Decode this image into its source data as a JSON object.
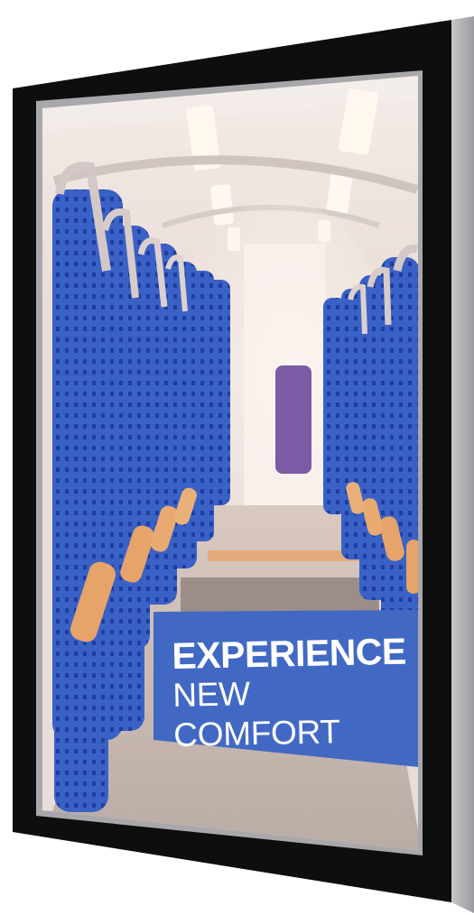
{
  "poster": {
    "headline_line1": "EXPERIENCE",
    "headline_line2": "NEW COMFORT"
  },
  "colors": {
    "frame": "#0d0d0d",
    "frame_edge": "#b9b9bc",
    "seat_blue": "#3b63c9",
    "banner_blue": "#4169c4",
    "armrest_orange": "#e6a36a",
    "ceiling": "#efe6e2"
  }
}
